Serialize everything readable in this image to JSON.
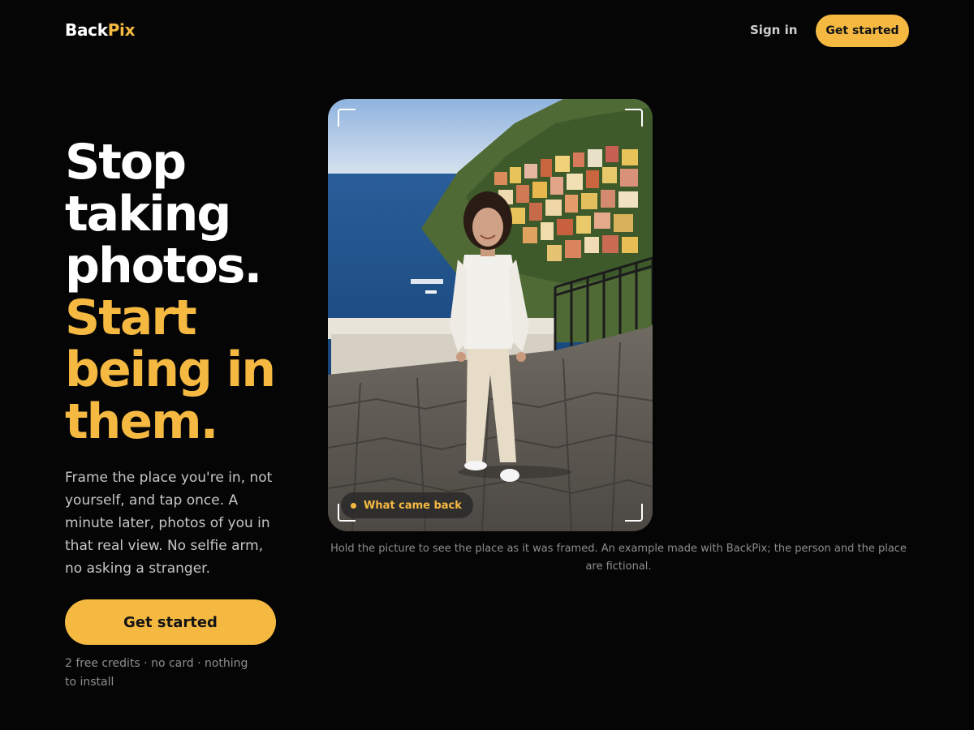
{
  "brand": {
    "name_part1": "Back",
    "name_part2": "Pix"
  },
  "header": {
    "sign_in": "Sign in",
    "get_started": "Get started"
  },
  "hero": {
    "headline_white": [
      "Stop",
      "taking",
      "photos."
    ],
    "headline_yellow": [
      "Start",
      "being in",
      "them."
    ],
    "lede": "Frame the place you're in, not yourself, and tap once. A minute later, photos of you in that real view. No selfie arm, no asking a stranger.",
    "cta": "Get started",
    "fineprint": "2 free credits · no card · nothing to install"
  },
  "photo": {
    "badge": "What came back",
    "caption": "Hold the picture to see the place as it was framed. An example made with BackPix; the person and the place are fictional."
  },
  "colors": {
    "background": "#050505",
    "accent": "#f5b942",
    "muted_text": "#8e8e8e"
  },
  "icons": [
    "viewfinder-corner-icon",
    "status-dot-icon"
  ]
}
